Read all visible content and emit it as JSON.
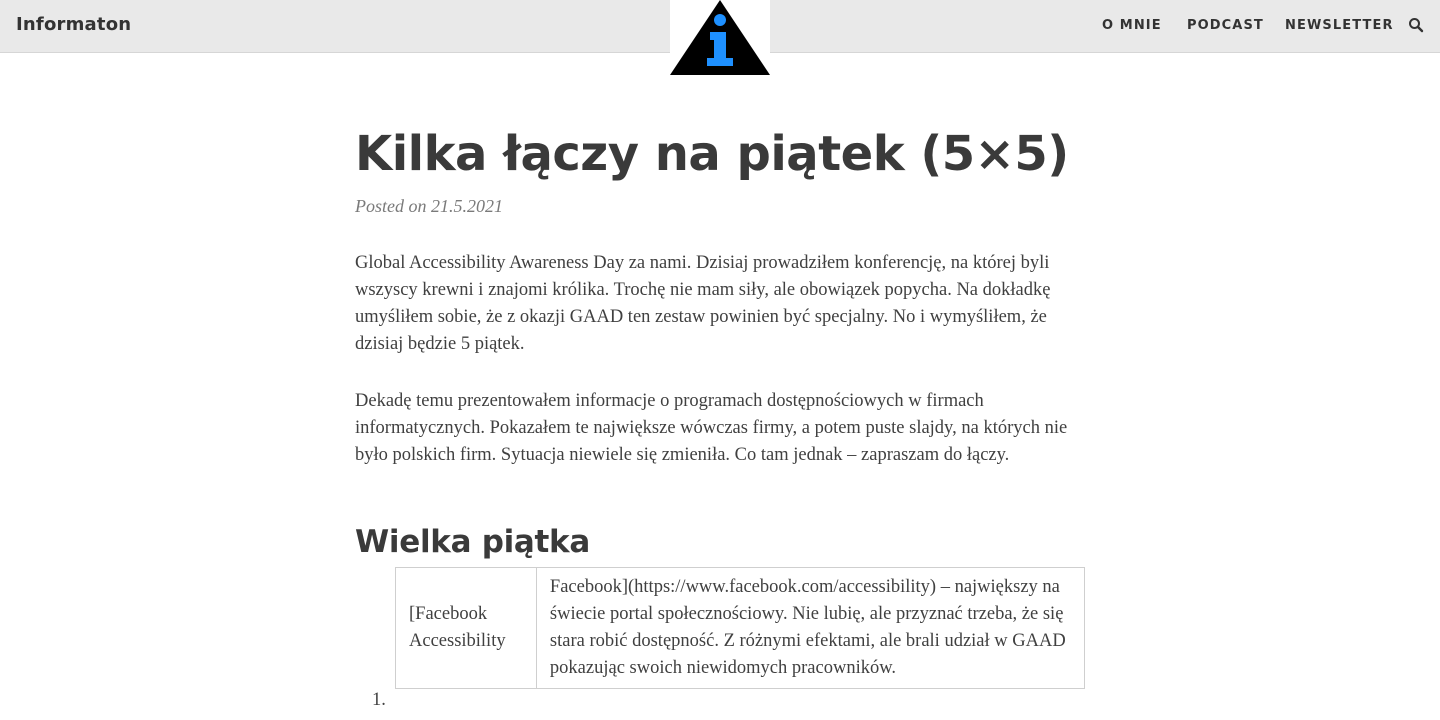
{
  "site": {
    "name": "Informaton",
    "logo_icon": "info-triangle-icon",
    "logo_accent": "#1e90ff"
  },
  "nav": {
    "items": [
      {
        "label": "O MNIE"
      },
      {
        "label": "PODCAST"
      },
      {
        "label": "NEWSLETTER"
      }
    ],
    "search_icon": "search-icon"
  },
  "post": {
    "title": "Kilka łączy na piątek (5×5)",
    "posted": "Posted on 21.5.2021",
    "paragraphs": [
      "Global Accessibility Awareness Day za nami. Dzisiaj prowadziłem konferencję, na której byli wszyscy krewni i znajomi królika. Trochę nie mam siły, ale obowiązek popycha. Na dokładkę umyśliłem sobie, że z okazji GAAD ten zestaw powinien być specjalny. No i wymyśliłem, że dzisiaj będzie 5 piątek.",
      "Dekadę temu prezentowałem informacje o programach dostępnościowych w firmach informatycznych. Pokazałem te największe wówczas firmy, a potem puste slajdy, na których nie było polskich firm. Sytuacja niewiele się zmieniła. Co tam jednak – zapraszam do łączy."
    ],
    "section_heading": "Wielka piątka",
    "list": [
      {
        "number": "1.",
        "cell1": "[Facebook Accessibility",
        "cell2": "Facebook](https://www.facebook.com/accessibility) – największy na świecie portal społecznościowy. Nie lubię, ale przyznać trzeba, że się stara robić dostępność. Z różnymi efektami, ale brali udział w GAAD pokazując swoich niewidomych pracowników."
      }
    ]
  }
}
